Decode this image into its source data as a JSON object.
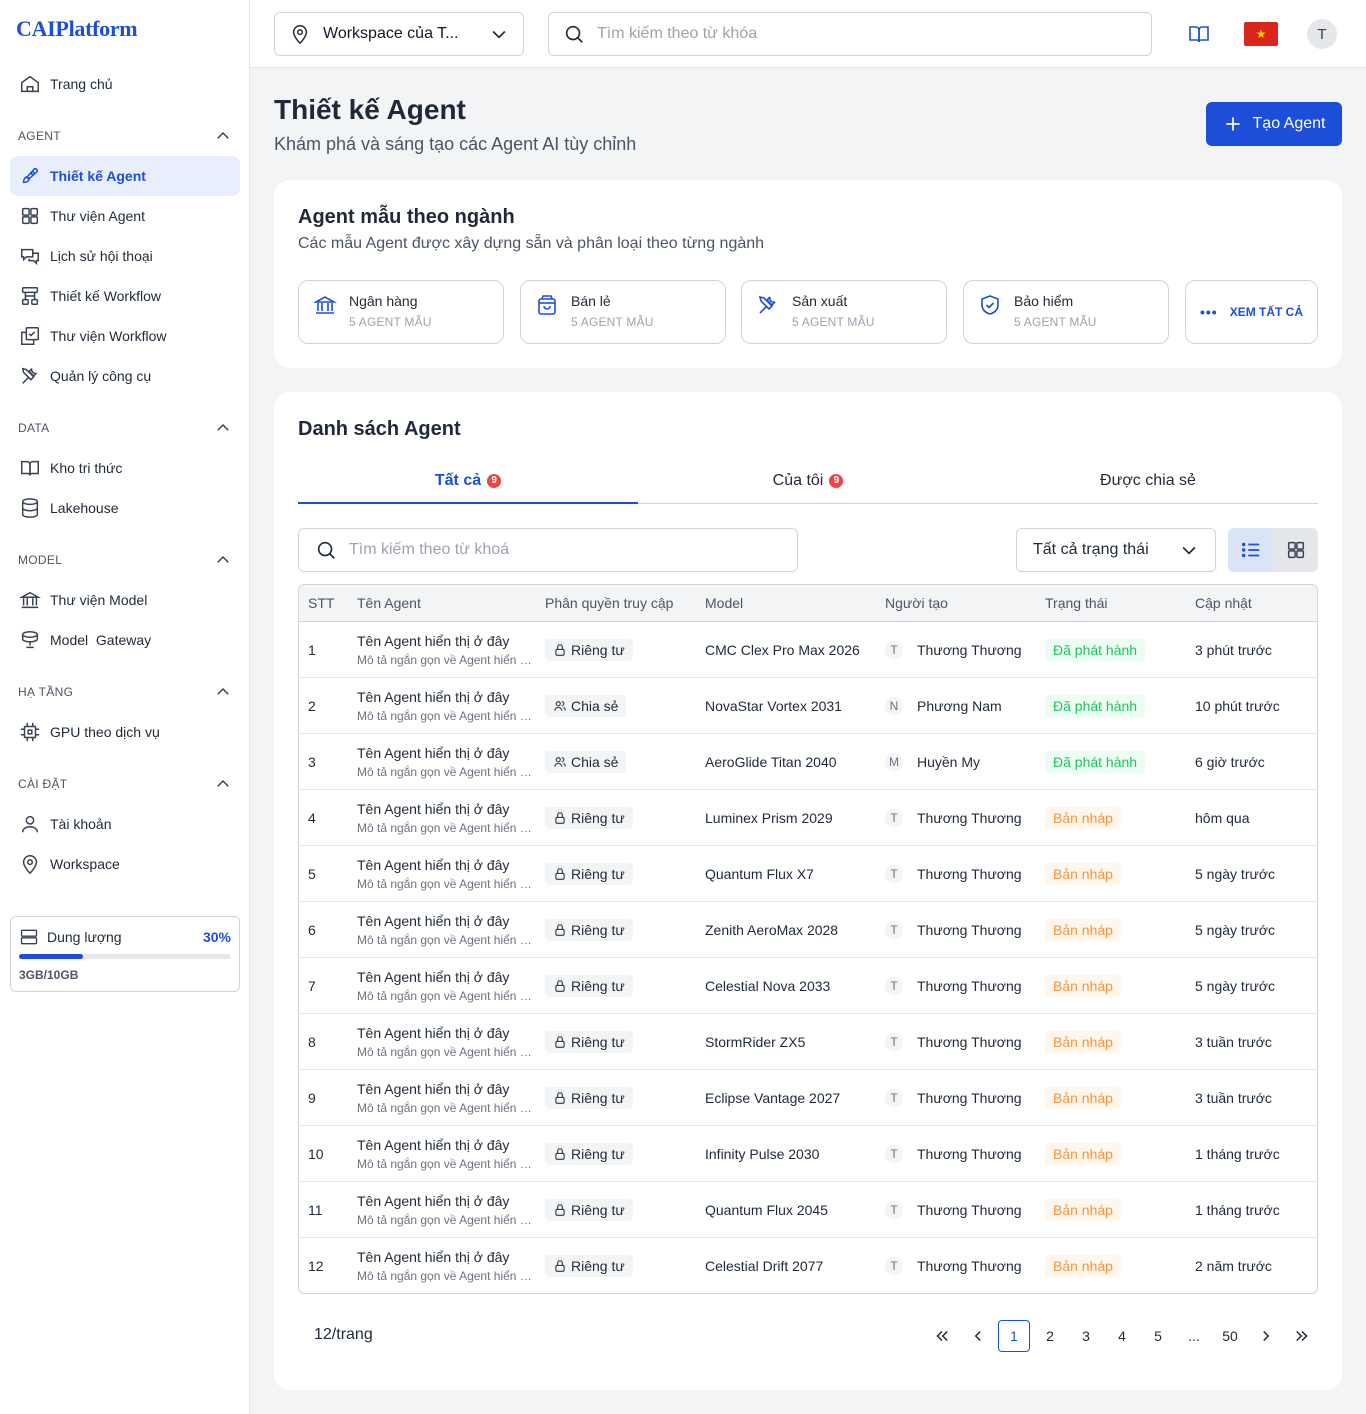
{
  "brand": {
    "logo": "CAIPlatform"
  },
  "sidebar": {
    "home": "Trang chủ",
    "sections": [
      {
        "title": "AGENT",
        "items": [
          "Thiết kế Agent",
          "Thư viện Agent",
          "Lịch sử hội thoại",
          "Thiết kế Workflow",
          "Thư viện Workflow",
          "Quản lý công cụ"
        ]
      },
      {
        "title": "DATA",
        "items": [
          "Kho tri thức",
          "Lakehouse"
        ]
      },
      {
        "title": "MODEL",
        "items": [
          "Thư viện Model",
          "Model  Gateway"
        ]
      },
      {
        "title": "HẠ TẦNG",
        "items": [
          "GPU theo dịch vụ"
        ]
      },
      {
        "title": "CÀI ĐẶT",
        "items": [
          "Tài khoản",
          "Workspace"
        ]
      }
    ],
    "active_item": "Thiết kế Agent",
    "storage": {
      "label": "Dung lượng",
      "percent_text": "30%",
      "percent": 0.3,
      "caption": "3GB/10GB"
    }
  },
  "header": {
    "workspace": "Workspace của T...",
    "search_placeholder": "Tìm kiếm theo từ khóa",
    "flag_star": "★",
    "avatar": "T"
  },
  "page": {
    "title": "Thiết kế Agent",
    "subtitle": "Khám phá và sáng tạo các Agent AI tùy chỉnh",
    "create_label": "Tạo Agent"
  },
  "templates": {
    "title": "Agent mẫu theo ngành",
    "subtitle": "Các mẫu Agent được xây dựng sẵn và phân loại theo từng ngành",
    "industries": [
      {
        "name": "Ngân hàng",
        "count": "5 AGENT MẪU",
        "icon": "bank-icon"
      },
      {
        "name": "Bán lẻ",
        "count": "5 AGENT MẪU",
        "icon": "shopping-bag-icon"
      },
      {
        "name": "Sản xuất",
        "count": "5 AGENT MẪU",
        "icon": "tools-icon"
      },
      {
        "name": "Bảo hiểm",
        "count": "5 AGENT MẪU",
        "icon": "shield-check-icon"
      }
    ],
    "see_all": "XEM TẤT CẢ"
  },
  "list": {
    "title": "Danh sách Agent",
    "tabs": [
      {
        "label": "Tất cả",
        "badge": "9"
      },
      {
        "label": "Của tôi",
        "badge": "9"
      },
      {
        "label": "Được chia sẻ",
        "badge": ""
      }
    ],
    "search_placeholder": "Tìm kiếm theo từ khoá",
    "status_filter": "Tất cả trạng thái",
    "columns": [
      "STT",
      "Tên Agent",
      "Phân quyền truy cập",
      "Model",
      "Người tạo",
      "Trạng thái",
      "Cập nhật"
    ],
    "rows": [
      {
        "stt": "1",
        "name": "Tên Agent hiển thị ở đây",
        "desc": "Mô tả ngắn gọn về Agent hiển thị ở đây",
        "perm": "Riêng tư",
        "model": "CMC Clex Pro Max 2026",
        "user_initial": "T",
        "user": "Thương Thương",
        "status": "Đã phát hành",
        "updated": "3 phút trước"
      },
      {
        "stt": "2",
        "name": "Tên Agent hiển thị ở đây",
        "desc": "Mô tả ngắn gọn về Agent hiển thị ở đây",
        "perm": "Chia sẻ",
        "model": "NovaStar Vortex 2031",
        "user_initial": "N",
        "user": "Phương Nam",
        "status": "Đã phát hành",
        "updated": "10 phút trước"
      },
      {
        "stt": "3",
        "name": "Tên Agent hiển thị ở đây",
        "desc": "Mô tả ngắn gọn về Agent hiển thị ở đây",
        "perm": "Chia sẻ",
        "model": "AeroGlide Titan 2040",
        "user_initial": "M",
        "user": "Huyền My",
        "status": "Đã phát hành",
        "updated": "6 giờ trước"
      },
      {
        "stt": "4",
        "name": "Tên Agent hiển thị ở đây",
        "desc": "Mô tả ngắn gọn về Agent hiển thị ở đây",
        "perm": "Riêng tư",
        "model": "Luminex Prism 2029",
        "user_initial": "T",
        "user": "Thương Thương",
        "status": "Bản nháp",
        "updated": "hôm qua"
      },
      {
        "stt": "5",
        "name": "Tên Agent hiển thị ở đây",
        "desc": "Mô tả ngắn gọn về Agent hiển thị ở đây",
        "perm": "Riêng tư",
        "model": "Quantum Flux X7",
        "user_initial": "T",
        "user": "Thương Thương",
        "status": "Bản nháp",
        "updated": "5 ngày trước"
      },
      {
        "stt": "6",
        "name": "Tên Agent hiển thị ở đây",
        "desc": "Mô tả ngắn gọn về Agent hiển thị ở đây",
        "perm": "Riêng tư",
        "model": "Zenith AeroMax 2028",
        "user_initial": "T",
        "user": "Thương Thương",
        "status": "Bản nháp",
        "updated": "5 ngày trước"
      },
      {
        "stt": "7",
        "name": "Tên Agent hiển thị ở đây",
        "desc": "Mô tả ngắn gọn về Agent hiển thị ở đây",
        "perm": "Riêng tư",
        "model": "Celestial Nova 2033",
        "user_initial": "T",
        "user": "Thương Thương",
        "status": "Bản nháp",
        "updated": "5 ngày trước"
      },
      {
        "stt": "8",
        "name": "Tên Agent hiển thị ở đây",
        "desc": "Mô tả ngắn gọn về Agent hiển thị ở đây",
        "perm": "Riêng tư",
        "model": "StormRider ZX5",
        "user_initial": "T",
        "user": "Thương Thương",
        "status": "Bản nháp",
        "updated": "3 tuần trước"
      },
      {
        "stt": "9",
        "name": "Tên Agent hiển thị ở đây",
        "desc": "Mô tả ngắn gọn về Agent hiển thị ở đây",
        "perm": "Riêng tư",
        "model": "Eclipse Vantage 2027",
        "user_initial": "T",
        "user": "Thương Thương",
        "status": "Bản nháp",
        "updated": "3 tuần trước"
      },
      {
        "stt": "10",
        "name": "Tên Agent hiển thị ở đây",
        "desc": "Mô tả ngắn gọn về Agent hiển thị ở đây",
        "perm": "Riêng tư",
        "model": "Infinity Pulse 2030",
        "user_initial": "T",
        "user": "Thương Thương",
        "status": "Bản nháp",
        "updated": "1 tháng trước"
      },
      {
        "stt": "11",
        "name": "Tên Agent hiển thị ở đây",
        "desc": "Mô tả ngắn gọn về Agent hiển thị ở đây",
        "perm": "Riêng tư",
        "model": "Quantum Flux 2045",
        "user_initial": "T",
        "user": "Thương Thương",
        "status": "Bản nháp",
        "updated": "1 tháng trước"
      },
      {
        "stt": "12",
        "name": "Tên Agent hiển thị ở đây",
        "desc": "Mô tả ngắn gọn về Agent hiển thị ở đây",
        "perm": "Riêng tư",
        "model": "Celestial Drift 2077",
        "user_initial": "T",
        "user": "Thương Thương",
        "status": "Bản nháp",
        "updated": "2 năm trước"
      }
    ],
    "per_page": "12/trang",
    "pages": [
      "1",
      "2",
      "3",
      "4",
      "5",
      "...",
      "50"
    ],
    "current_page": "1"
  },
  "colors": {
    "accent": "#1d4ed8",
    "published": "#22c55e",
    "draft": "#fb923c",
    "badge": "#ef4444"
  }
}
